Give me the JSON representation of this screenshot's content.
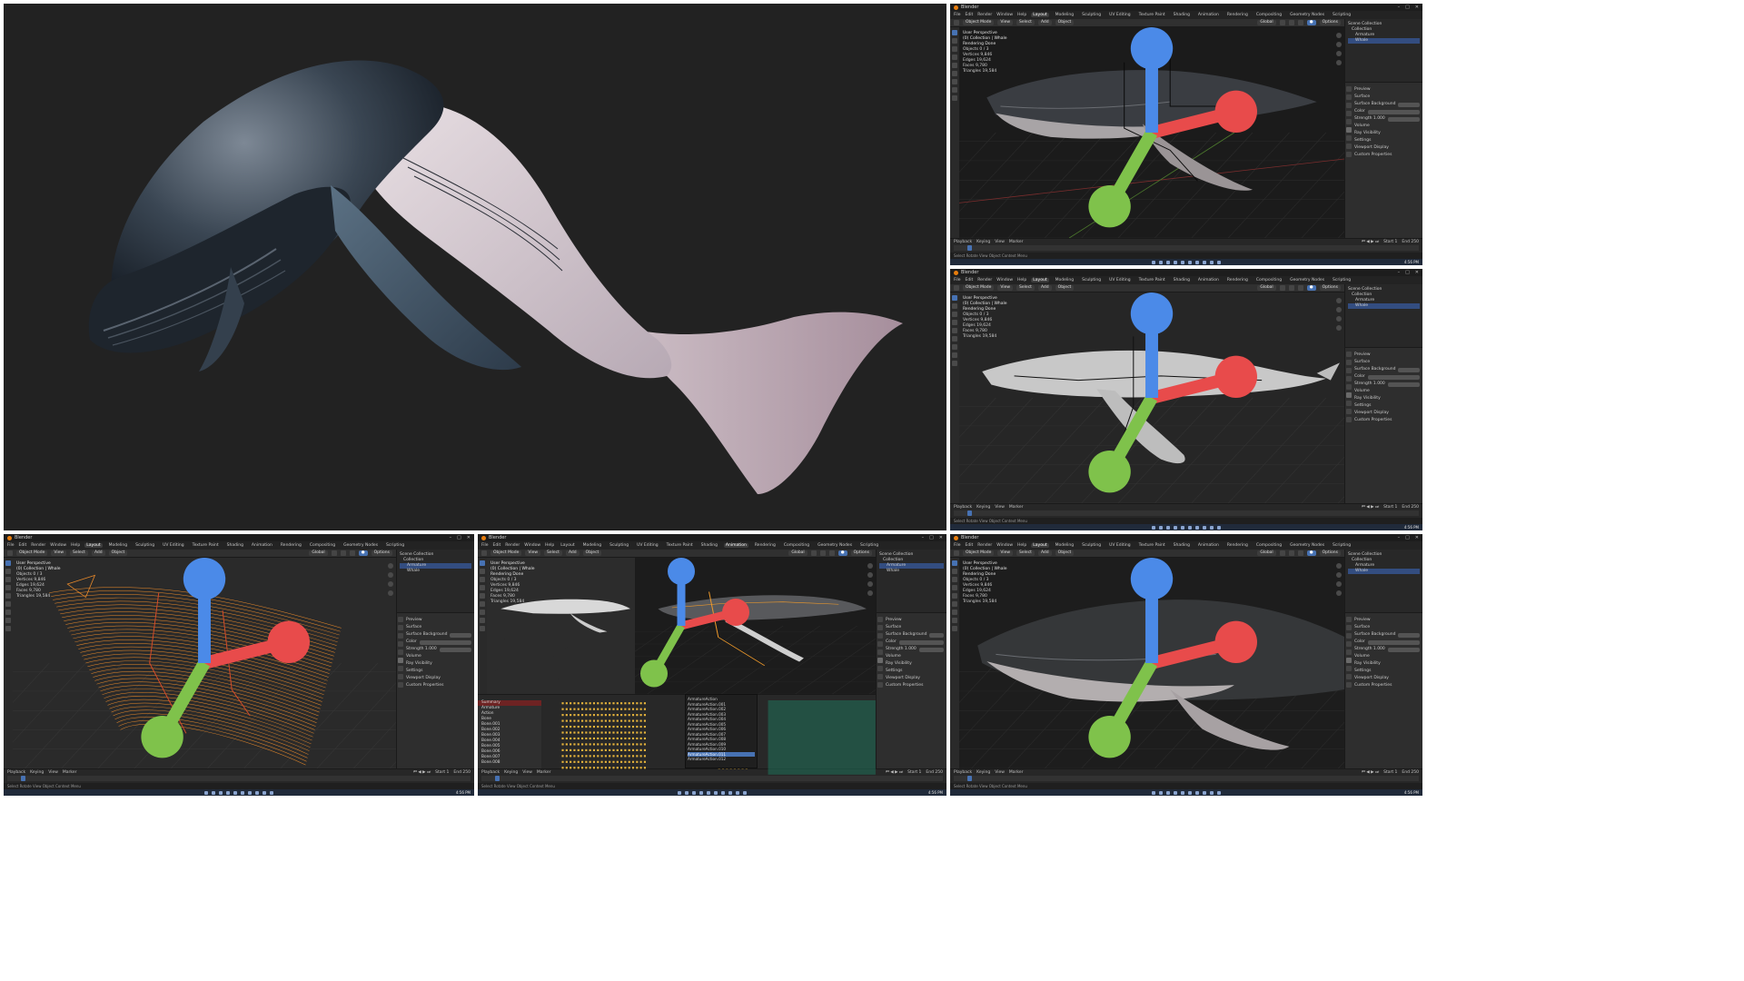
{
  "app": {
    "title": "Blender",
    "menus": [
      "File",
      "Edit",
      "Render",
      "Window",
      "Help"
    ],
    "workspaces": [
      "Layout",
      "Modeling",
      "Sculpting",
      "UV Editing",
      "Texture Paint",
      "Shading",
      "Animation",
      "Rendering",
      "Compositing",
      "Geometry Nodes",
      "Scripting"
    ],
    "active_workspace": "Layout"
  },
  "header": {
    "mode": "Object Mode",
    "view": "View",
    "select": "Select",
    "add": "Add",
    "object": "Object",
    "transform": "Global",
    "options": "Options"
  },
  "viewport_overlay": {
    "view_name": "User Perspective",
    "collection": "(0) Collection | Whale",
    "rendering": "Rendering Done",
    "stats": [
      "Objects   0 / 3",
      "Vertices  9,846",
      "Edges     19,624",
      "Faces     9,780",
      "Triangles 19,584"
    ]
  },
  "outliner": {
    "rows": [
      "Scene Collection",
      "Collection",
      "Armature",
      "Whale"
    ]
  },
  "properties": {
    "rows": [
      "Preview",
      "Surface",
      "Surface   Background",
      "Color",
      "Strength  1.000",
      "Volume",
      "Ray Visibility",
      "Settings",
      "Viewport Display",
      "Custom Properties"
    ]
  },
  "timeline": {
    "menus": [
      "Playback",
      "Keying",
      "View",
      "Marker"
    ],
    "start": "Start 1",
    "end": "End 250"
  },
  "statusbar": {
    "text": "Select        Rotate View        Object Context Menu"
  },
  "taskbar": {
    "clock": "4:56 PM"
  },
  "dopesheet": {
    "channels": [
      "Summary",
      "Armature",
      "Action",
      "Bone",
      "Bone.001",
      "Bone.002",
      "Bone.003",
      "Bone.004",
      "Bone.005",
      "Bone.006",
      "Bone.007",
      "Bone.008"
    ]
  },
  "action_list": {
    "items": [
      "ArmatureAction",
      "ArmatureAction.001",
      "ArmatureAction.002",
      "ArmatureAction.003",
      "ArmatureAction.004",
      "ArmatureAction.005",
      "ArmatureAction.006",
      "ArmatureAction.007",
      "ArmatureAction.008",
      "ArmatureAction.009",
      "ArmatureAction.010",
      "ArmatureAction.011",
      "ArmatureAction.012"
    ],
    "selected_index": 11
  }
}
